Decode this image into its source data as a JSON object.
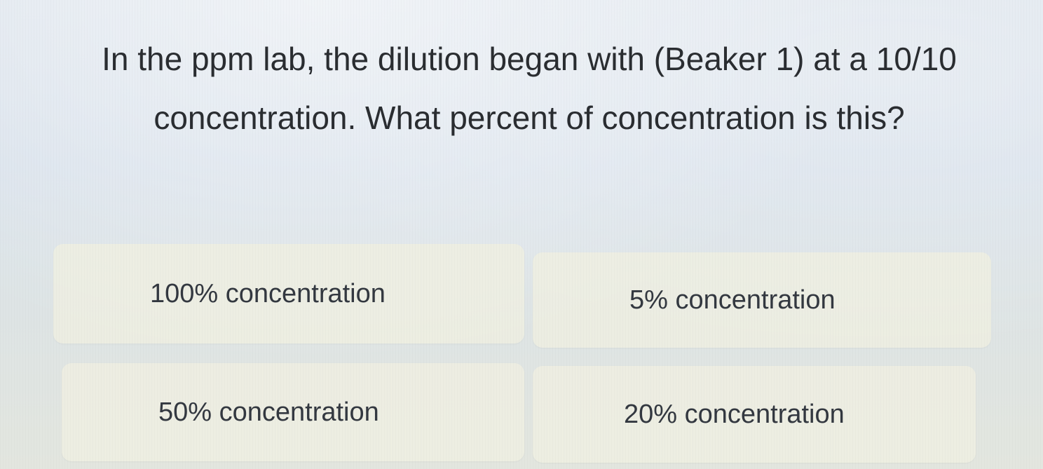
{
  "question": {
    "text": "In the ppm lab, the dilution began with (Beaker 1) at a 10/10 concentration. What percent of concentration is this?"
  },
  "options": [
    {
      "label": "100% concentration"
    },
    {
      "label": "5% concentration"
    },
    {
      "label": "50% concentration"
    },
    {
      "label": "20% concentration"
    }
  ]
}
